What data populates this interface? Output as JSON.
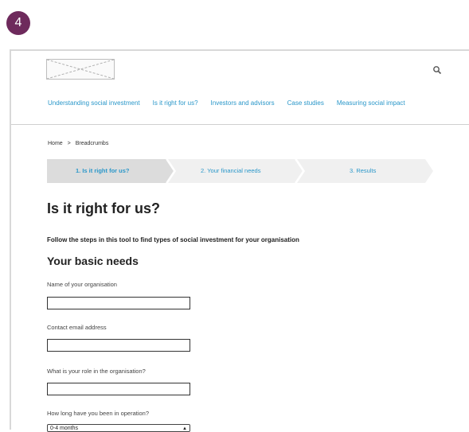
{
  "badge": {
    "number": "4"
  },
  "colors": {
    "badge": "#6e2a5c",
    "link": "#2a97c9",
    "step_active": "#dcdcdc",
    "step_inactive": "#f0f0f0"
  },
  "header": {
    "search_icon": "search-icon"
  },
  "nav": {
    "items": [
      "Understanding social investment",
      "Is it right for us?",
      "Investors and advisors",
      "Case studies",
      "Measuring social impact"
    ]
  },
  "breadcrumb": {
    "home": "Home",
    "separator": ">",
    "current": "Breadcrumbs"
  },
  "steps": {
    "active_index": 0,
    "labels": [
      "1. Is it right for us?",
      "2. Your financial needs",
      "3. Results"
    ]
  },
  "page": {
    "title": "Is it right for us?",
    "intro": "Follow the steps in this tool to find types of social investment for your organisation",
    "section_title": "Your basic needs"
  },
  "form": {
    "org_name_label": "Name of your organisation",
    "org_name_value": "",
    "email_label": "Contact email address",
    "email_value": "",
    "role_label": "What is your role in the organisation?",
    "role_value": "",
    "duration_label": "How long have you been in operation?",
    "duration_selected": "0-4 months"
  }
}
